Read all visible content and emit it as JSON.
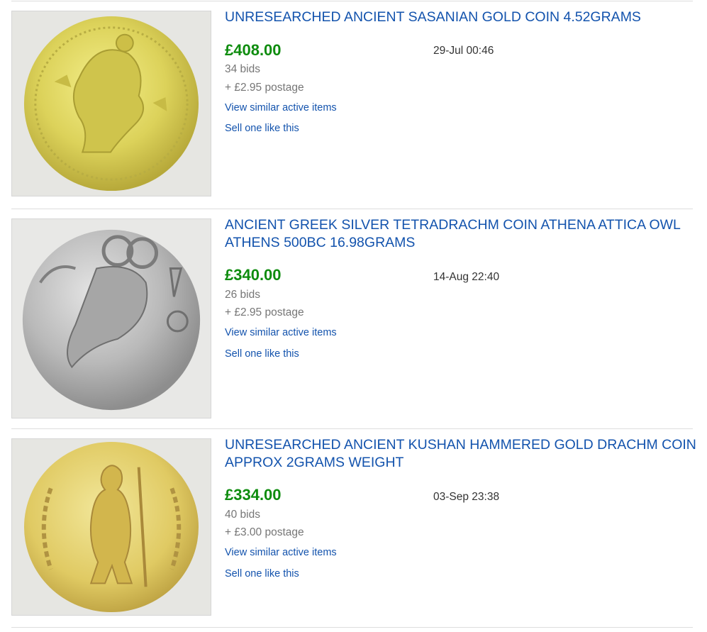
{
  "listings": [
    {
      "title": "UNRESEARCHED ANCIENT SASANIAN GOLD COIN 4.52GRAMS",
      "price": "£408.00",
      "date": "29-Jul 00:46",
      "bids": "34 bids",
      "postage": "+ £2.95 postage",
      "similar": "View similar active items",
      "sell": "Sell one like this",
      "image": "gold-coin-sasanian-bust"
    },
    {
      "title": "ANCIENT GREEK SILVER TETRADRACHM COIN ATHENA ATTICA OWL ATHENS 500BC 16.98GRAMS",
      "price": "£340.00",
      "date": "14-Aug 22:40",
      "bids": "26 bids",
      "postage": "+ £2.95 postage",
      "similar": "View similar active items",
      "sell": "Sell one like this",
      "image": "silver-tetradrachm-owl"
    },
    {
      "title": "UNRESEARCHED ANCIENT KUSHAN HAMMERED GOLD DRACHM COIN APPROX 2GRAMS WEIGHT",
      "price": "£334.00",
      "date": "03-Sep 23:38",
      "bids": "40 bids",
      "postage": "+ £3.00 postage",
      "similar": "View similar active items",
      "sell": "Sell one like this",
      "image": "gold-drachm-kushan-figure"
    }
  ],
  "colors": {
    "title_link": "#1353ad",
    "price": "#0e8c0e",
    "muted": "#767676",
    "divider": "#dddddd"
  }
}
